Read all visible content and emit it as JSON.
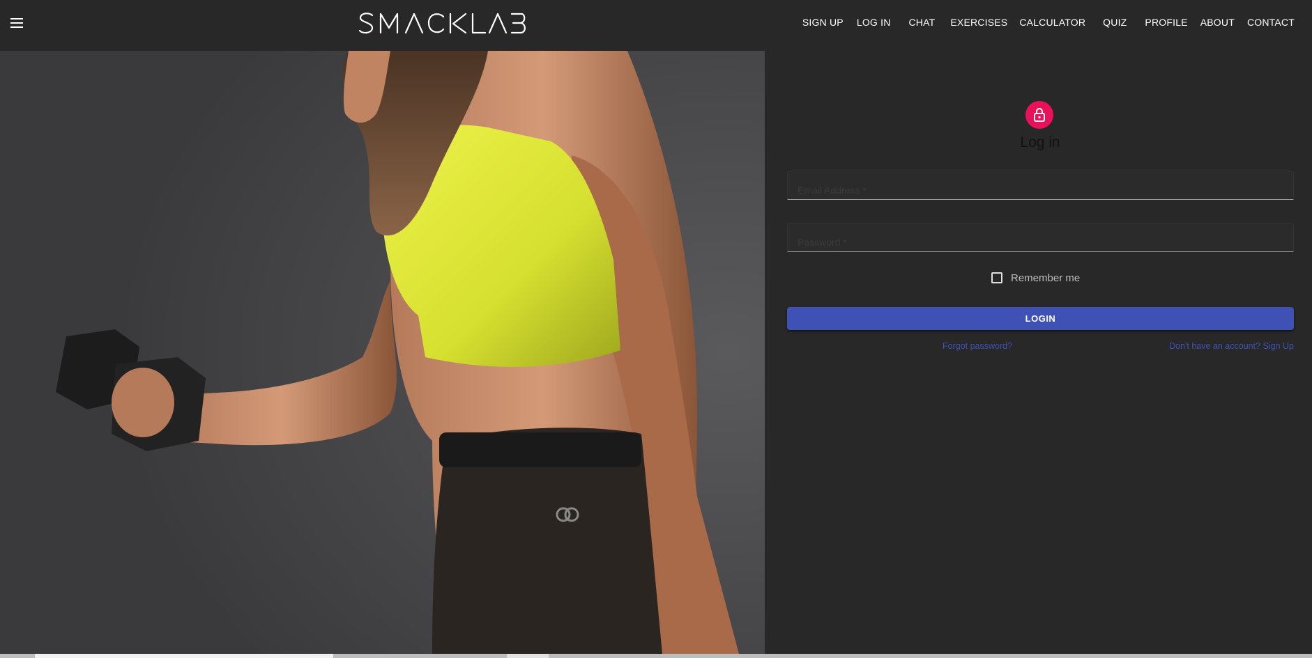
{
  "brand": {
    "logo_text": "SMACKLAB"
  },
  "nav": {
    "items": [
      {
        "label": "SIGN UP"
      },
      {
        "label": "LOG IN"
      },
      {
        "label": "CHAT"
      },
      {
        "label": "EXERCISES"
      },
      {
        "label": "CALCULATOR"
      },
      {
        "label": "QUIZ"
      },
      {
        "label": "PROFILE"
      },
      {
        "label": "ABOUT"
      },
      {
        "label": "CONTACT"
      }
    ]
  },
  "icons": {
    "menu": "menu-icon",
    "lock": "lock-icon"
  },
  "login": {
    "title": "Log in",
    "email_placeholder": "Email Address *",
    "email_value": "",
    "password_placeholder": "Password *",
    "password_value": "",
    "remember_label": "Remember me",
    "remember_checked": false,
    "submit_label": "LOGIN",
    "forgot_link": "Forgot password?",
    "signup_link": "Don't have an account? Sign Up"
  },
  "colors": {
    "background": "#282828",
    "accent_pink": "#e8115a",
    "primary_blue": "#3f51b5",
    "top_color": "#dfe83a"
  }
}
